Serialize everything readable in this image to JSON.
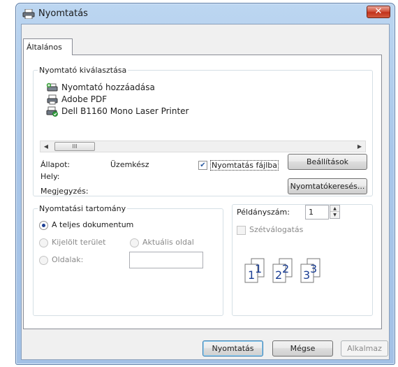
{
  "window": {
    "title": "Nyomtatás",
    "close_label": "✕"
  },
  "tabs": [
    {
      "label": "Általános"
    }
  ],
  "printer_select": {
    "legend": "Nyomtató kiválasztása",
    "printers": [
      {
        "label": "Nyomtató hozzáadása",
        "icon": "add-printer-icon"
      },
      {
        "label": "Adobe PDF",
        "icon": "printer-icon"
      },
      {
        "label": "Dell B1160 Mono Laser Printer",
        "icon": "default-printer-icon"
      }
    ],
    "scroll_thumb_label": "III",
    "status_label": "Állapot:",
    "status_value": "Üzemkész",
    "location_label": "Hely:",
    "comment_label": "Megjegyzés:",
    "print_to_file_label": "Nyomtatás fájlba",
    "print_to_file_checked": true,
    "preferences_button": "Beállítások",
    "find_printer_button": "Nyomtatókeresés..."
  },
  "page_range": {
    "legend": "Nyomtatási tartomány",
    "all_label": "A teljes dokumentum",
    "selection_label": "Kijelölt terület",
    "current_page_label": "Aktuális oldal",
    "pages_label": "Oldalak:",
    "pages_value": ""
  },
  "copies": {
    "copies_label": "Példányszám:",
    "copies_value": "1",
    "collate_label": "Szétválogatás",
    "collate_checked": false,
    "collate_pages": [
      "1",
      "1",
      "2",
      "2",
      "3",
      "3"
    ]
  },
  "buttons": {
    "print": "Nyomtatás",
    "cancel": "Mégse",
    "apply": "Alkalmaz"
  },
  "colors": {
    "accent": "#1c3f94",
    "titlebar": "#a9c7ea",
    "close": "#c2321b"
  }
}
